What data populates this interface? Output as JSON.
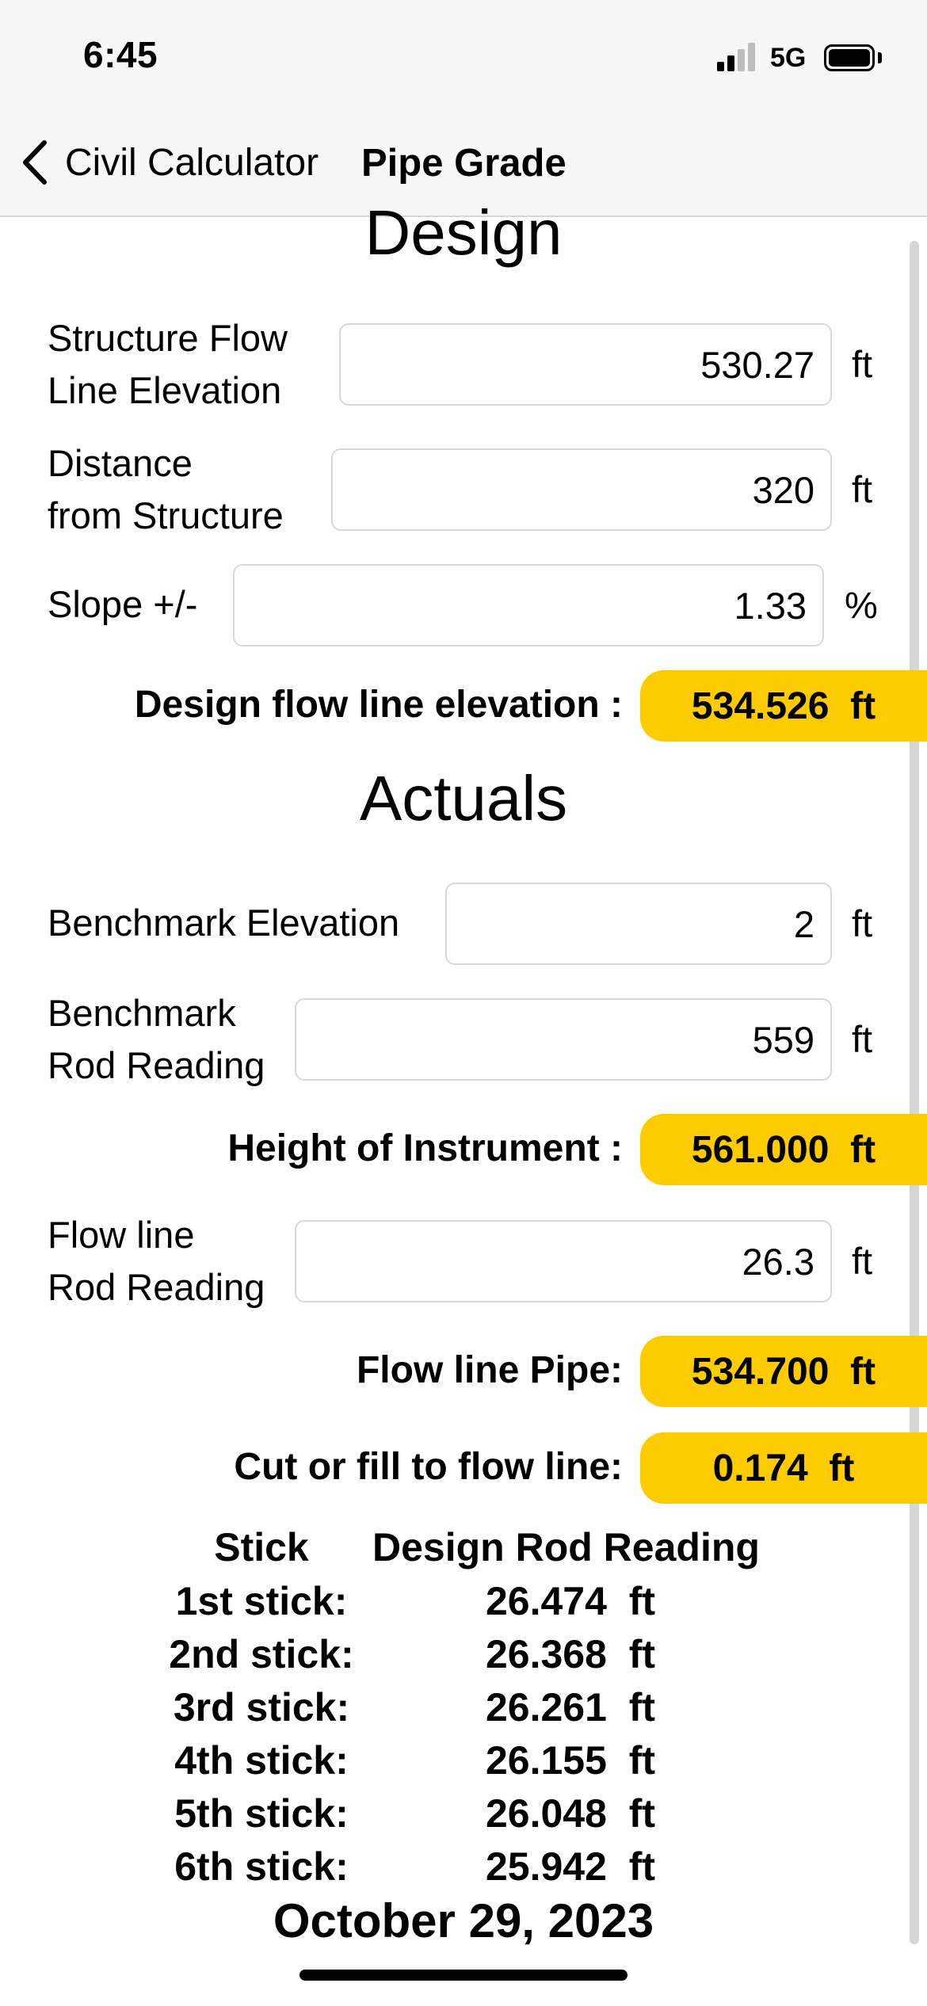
{
  "status": {
    "time": "6:45",
    "network": "5G"
  },
  "nav": {
    "back_label": "Civil Calculator",
    "title": "Pipe Grade"
  },
  "design": {
    "heading": "Design",
    "structure_flow": {
      "label_line1": "Structure Flow",
      "label_line2": "Line Elevation",
      "value": "530.27",
      "unit": "ft"
    },
    "distance": {
      "label_line1": "Distance",
      "label_line2": "from Structure",
      "value": "320",
      "unit": "ft"
    },
    "slope": {
      "label": "Slope +/-",
      "value": "1.33",
      "unit": "%"
    },
    "result": {
      "label": "Design flow line elevation :",
      "value": "534.526  ft"
    }
  },
  "actuals": {
    "heading": "Actuals",
    "benchmark_elevation": {
      "label": "Benchmark Elevation",
      "value": "2",
      "unit": "ft"
    },
    "benchmark_rod": {
      "label_line1": "Benchmark",
      "label_line2": "Rod Reading",
      "value": "559",
      "unit": "ft"
    },
    "hi_result": {
      "label": "Height of Instrument :",
      "value": "561.000  ft"
    },
    "flowline_rod": {
      "label_line1": "Flow line",
      "label_line2": "Rod Reading",
      "value": "26.3",
      "unit": "ft"
    },
    "flowline_pipe": {
      "label": "Flow line Pipe:",
      "value": "534.700  ft"
    },
    "cut_fill": {
      "label": "Cut or fill to flow line:",
      "value": "0.174  ft"
    }
  },
  "table": {
    "col_stick": "Stick",
    "col_reading": "Design Rod Reading",
    "rows": [
      {
        "stick": "1st stick:",
        "reading": "26.474  ft"
      },
      {
        "stick": "2nd stick:",
        "reading": "26.368  ft"
      },
      {
        "stick": "3rd stick:",
        "reading": "26.261  ft"
      },
      {
        "stick": "4th stick:",
        "reading": "26.155  ft"
      },
      {
        "stick": "5th stick:",
        "reading": "26.048  ft"
      },
      {
        "stick": "6th stick:",
        "reading": "25.942  ft"
      }
    ]
  },
  "date": "October 29, 2023",
  "colors": {
    "highlight": "#fccb00"
  }
}
